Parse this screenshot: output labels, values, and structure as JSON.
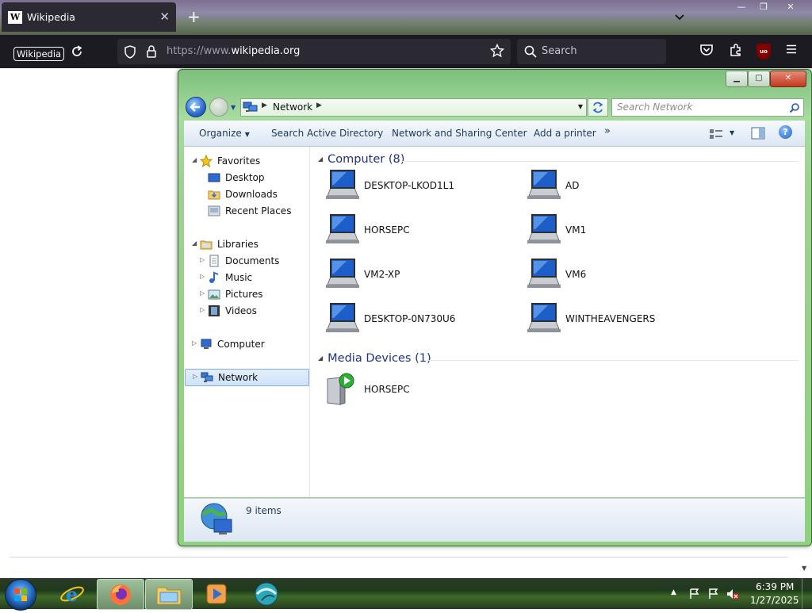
{
  "browser": {
    "tab_title": "Wikipedia",
    "tab_favicon": "W",
    "url_prefix": "https://www.",
    "url_domain": "wikipedia.org",
    "search_placeholder": "Search",
    "wiki_badge": "Wikipedia",
    "extension_badge": "uo"
  },
  "explorer": {
    "breadcrumb": "Network",
    "search_placeholder": "Search Network",
    "toolbar": {
      "organize": "Organize",
      "search_ad": "Search Active Directory",
      "sharing": "Network and Sharing Center",
      "printer": "Add a printer",
      "more": "»"
    },
    "nav": {
      "favorites": "Favorites",
      "desktop": "Desktop",
      "downloads": "Downloads",
      "recent": "Recent Places",
      "libraries": "Libraries",
      "documents": "Documents",
      "music": "Music",
      "pictures": "Pictures",
      "videos": "Videos",
      "computer": "Computer",
      "network": "Network"
    },
    "groups": {
      "computer": "Computer (8)",
      "media": "Media Devices (1)"
    },
    "computers": [
      "DESKTOP-LKOD1L1",
      "AD",
      "HORSEPC",
      "VM1",
      "VM2-XP",
      "VM6",
      "DESKTOP-0N730U6",
      "WINTHEAVENGERS"
    ],
    "media_devices": [
      "HORSEPC"
    ],
    "item_count": "9 items"
  },
  "taskbar": {
    "time": "6:39 PM",
    "date": "1/27/2025"
  },
  "colors": {
    "explorer_frame": "#8ed17e",
    "firefox_toolbar": "#1c1b22",
    "header_blue": "#1e3287"
  }
}
